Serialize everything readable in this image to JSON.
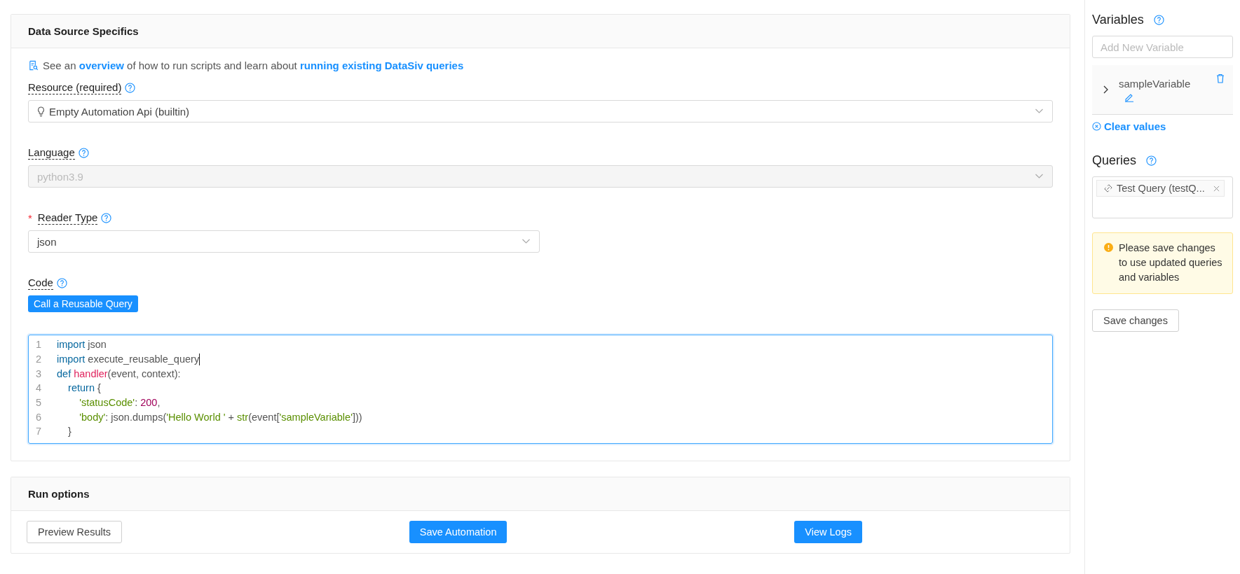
{
  "data_source": {
    "title": "Data Source Specifics",
    "intro": {
      "before": "See an ",
      "link1": "overview",
      "middle": " of how to run scripts and learn about ",
      "link2": "running existing DataSiv queries"
    },
    "fields": [
      {
        "label": "Resource (required)",
        "value": "Empty Automation Api (builtin)",
        "disabled": false
      },
      {
        "label": "Language",
        "value": "python3.9",
        "disabled": true
      },
      {
        "label": "Reader Type",
        "required_mark": "*",
        "value": "json",
        "disabled": false
      }
    ],
    "code_label": "Code",
    "reusable_button": "Call a Reusable Query",
    "code_lines": [
      {
        "number": "1",
        "cursor": false,
        "tokens": [
          {
            "kind": "keyword",
            "text": "import"
          },
          {
            "kind": "plain",
            "text": " json"
          }
        ]
      },
      {
        "number": "2",
        "cursor": true,
        "tokens": [
          {
            "kind": "keyword",
            "text": "import"
          },
          {
            "kind": "plain",
            "text": " execute_reusable_query"
          }
        ]
      },
      {
        "number": "3",
        "cursor": false,
        "tokens": [
          {
            "kind": "keyword",
            "text": "def"
          },
          {
            "kind": "function",
            "text": " handler"
          },
          {
            "kind": "punct",
            "text": "(event, context):"
          }
        ]
      },
      {
        "number": "4",
        "cursor": false,
        "tokens": [
          {
            "kind": "keyword",
            "text": "    return"
          },
          {
            "kind": "punct",
            "text": " {"
          }
        ]
      },
      {
        "number": "5",
        "cursor": false,
        "tokens": [
          {
            "kind": "string",
            "text": "        'statusCode'"
          },
          {
            "kind": "plain",
            "text": ": "
          },
          {
            "kind": "number",
            "text": "200"
          },
          {
            "kind": "punct",
            "text": ","
          }
        ]
      },
      {
        "number": "6",
        "cursor": false,
        "tokens": [
          {
            "kind": "string",
            "text": "        'body'"
          },
          {
            "kind": "plain",
            "text": ": json.dumps("
          },
          {
            "kind": "string",
            "text": "'Hello World '"
          },
          {
            "kind": "plain",
            "text": " + "
          },
          {
            "kind": "string",
            "text": "str"
          },
          {
            "kind": "punct",
            "text": "(event["
          },
          {
            "kind": "string",
            "text": "'sampleVariable'"
          },
          {
            "kind": "punct",
            "text": "]))"
          }
        ]
      },
      {
        "number": "7",
        "cursor": false,
        "tokens": [
          {
            "kind": "punct",
            "text": "    }"
          }
        ]
      }
    ]
  },
  "run_options": {
    "title": "Run options",
    "buttons": [
      {
        "label": "Preview Results",
        "kind": "default"
      },
      {
        "label": "Save Automation",
        "kind": "primary"
      },
      {
        "label": "View Logs",
        "kind": "primary"
      }
    ]
  },
  "sidebar": {
    "variables_title": "Variables",
    "variable_placeholder": "Add New Variable",
    "variables": [
      {
        "name": "sampleVariable",
        "expanded": false
      }
    ],
    "clear_values": "Clear values",
    "queries_title": "Queries",
    "queries": [
      {
        "label": "Test Query (testQ..."
      }
    ],
    "warning": "Please save changes to use updated queries and variables",
    "save_button": "Save changes"
  }
}
